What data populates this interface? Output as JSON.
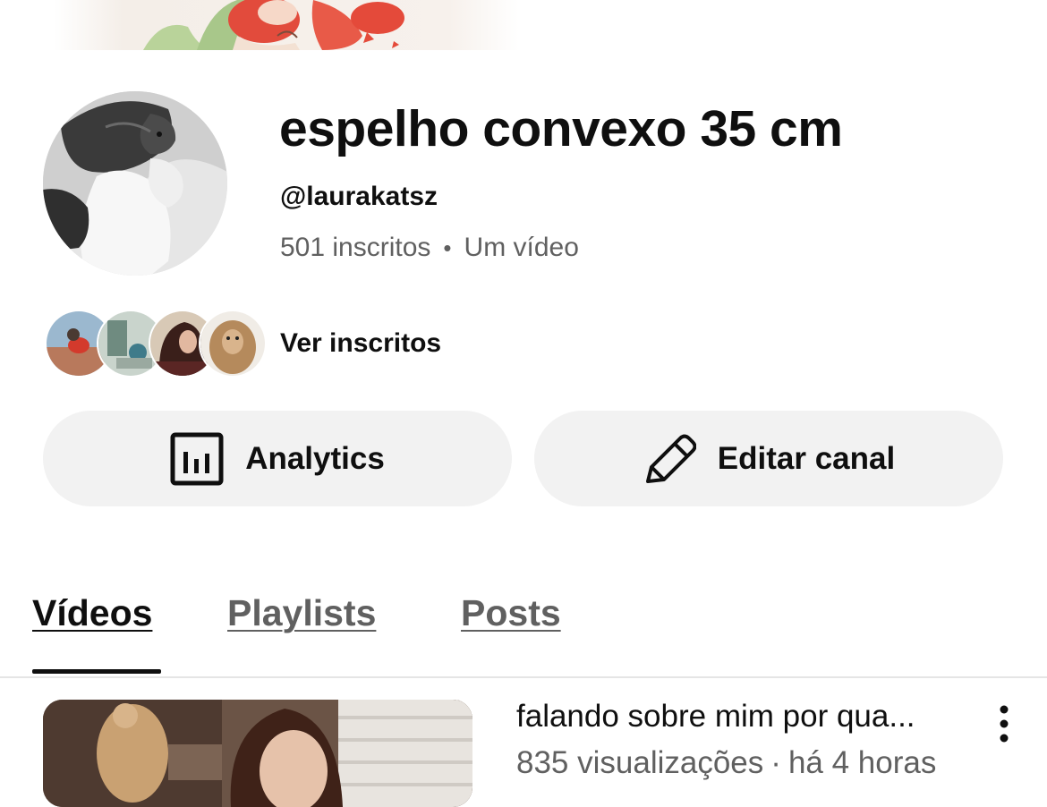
{
  "channel": {
    "name": "espelho convexo 35 cm",
    "handle": "@laurakatsz",
    "subscribers": "501 inscritos",
    "separator": "•",
    "video_count": "Um vídeo"
  },
  "subscribers_preview": {
    "link_label": "Ver inscritos"
  },
  "actions": {
    "analytics_label": "Analytics",
    "edit_label": "Editar canal"
  },
  "tabs": [
    {
      "label": "Vídeos",
      "active": true
    },
    {
      "label": "Playlists",
      "active": false
    },
    {
      "label": "Posts",
      "active": false
    }
  ],
  "videos": [
    {
      "title": "falando sobre mim por qua...",
      "views": "835 visualizações",
      "separator": "·",
      "age": "há 4 horas"
    }
  ],
  "icons": {
    "analytics": "bar-chart-icon",
    "edit": "pencil-icon",
    "more": "more-vertical-icon"
  },
  "colors": {
    "text_primary": "#0f0f0f",
    "text_secondary": "#606060",
    "pill_background": "#f2f2f2",
    "divider": "#e5e5e5"
  }
}
